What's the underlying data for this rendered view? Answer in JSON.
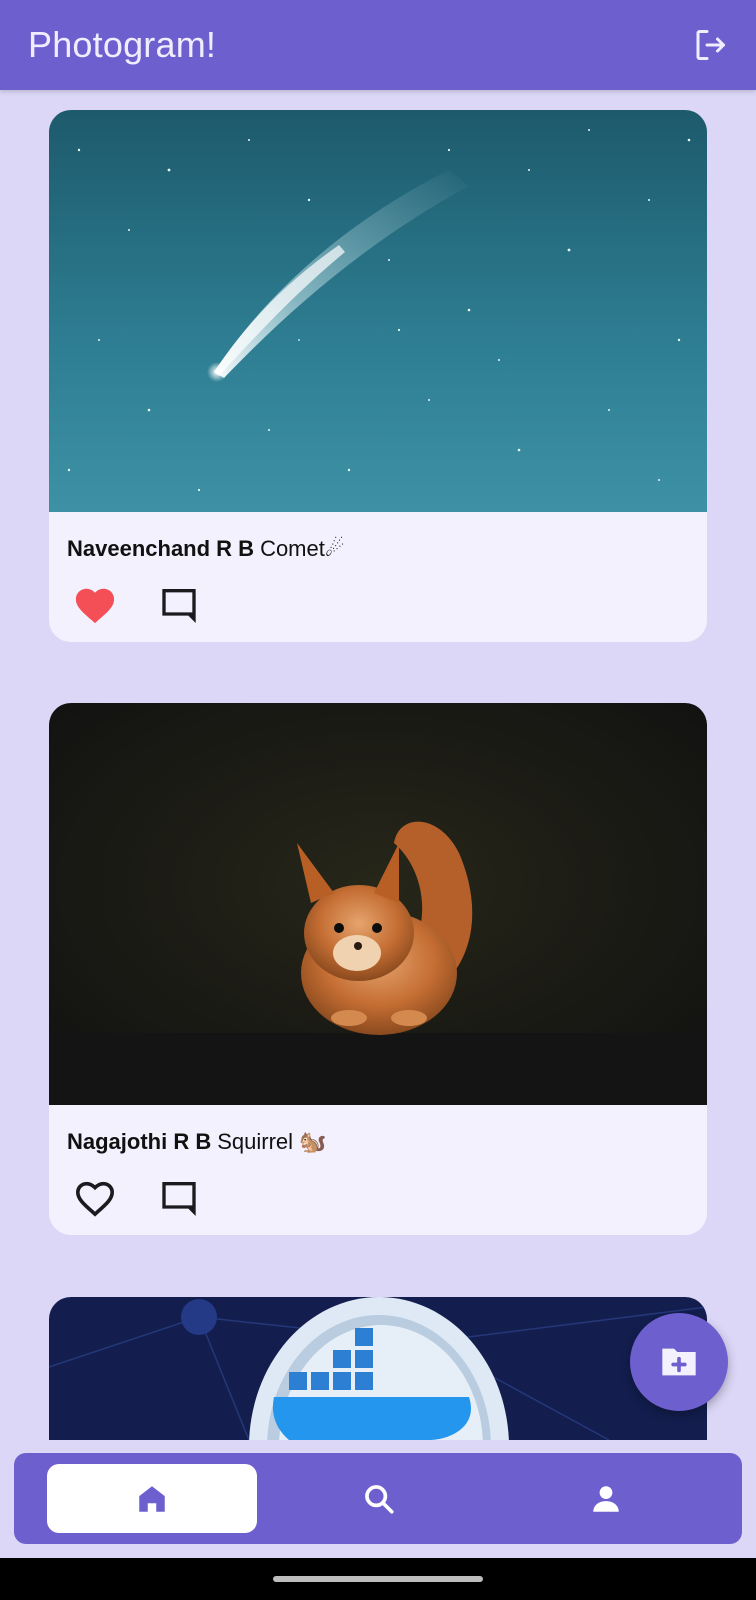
{
  "app_bar": {
    "title": "Photogram!",
    "logout_icon": "logout-icon"
  },
  "posts": [
    {
      "author": "Naveenchand R B",
      "caption": "Comet☄",
      "liked": true,
      "image": "comet-photo"
    },
    {
      "author": "Nagajothi R B",
      "caption": "Squirrel 🐿️",
      "liked": false,
      "image": "squirrel-photo"
    },
    {
      "author": "",
      "caption": "",
      "liked": false,
      "image": "docker-whale-photo"
    }
  ],
  "fab": {
    "icon": "add-folder-icon"
  },
  "bottom_nav": {
    "items": [
      {
        "icon": "home-icon",
        "active": true
      },
      {
        "icon": "search-icon",
        "active": false
      },
      {
        "icon": "profile-icon",
        "active": false
      }
    ]
  },
  "colors": {
    "primary": "#6e5fcf",
    "background": "#dcd7f7",
    "card": "#f3f1fd",
    "like": "#f44f57"
  }
}
